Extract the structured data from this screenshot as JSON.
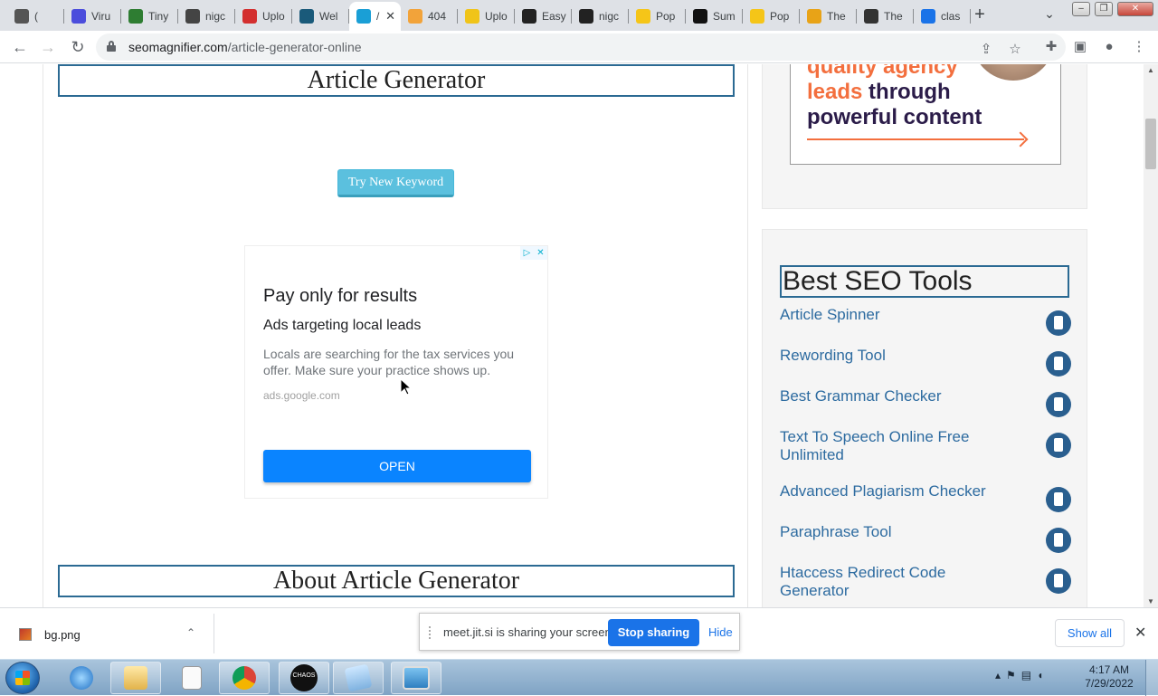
{
  "browser": {
    "tabs": [
      {
        "label": "(",
        "fav_color": "#555555",
        "icon": "pen-icon"
      },
      {
        "label": "Viru",
        "fav_color": "#4b4ddc",
        "icon": "sigma-icon"
      },
      {
        "label": "Tiny",
        "fav_color": "#2e7d32",
        "icon": "link-icon"
      },
      {
        "label": "nigc",
        "fav_color": "#444444",
        "icon": "mountain-icon"
      },
      {
        "label": "Uplo",
        "fav_color": "#d32f2f",
        "icon": "flame-icon"
      },
      {
        "label": "Wel",
        "fav_color": "#1a5a7a",
        "icon": "s-logo-icon"
      },
      {
        "label": "/",
        "fav_color": "#1a9fd6",
        "icon": "seo-icon"
      },
      {
        "label": "404",
        "fav_color": "#f2a33a",
        "icon": "rss-icon"
      },
      {
        "label": "Uplo",
        "fav_color": "#f0c419",
        "icon": "upload-icon"
      },
      {
        "label": "Easy",
        "fav_color": "#222222",
        "icon": "quill-icon"
      },
      {
        "label": "nigc",
        "fav_color": "#222222",
        "icon": "quill-icon"
      },
      {
        "label": "Pop",
        "fav_color": "#f5c518",
        "icon": "smiley-icon"
      },
      {
        "label": "Sum",
        "fav_color": "#111111",
        "icon": "chart-icon"
      },
      {
        "label": "Pop",
        "fav_color": "#f5c518",
        "icon": "smiley-icon"
      },
      {
        "label": "The",
        "fav_color": "#e8a317",
        "icon": "m-logo-icon"
      },
      {
        "label": "The",
        "fav_color": "#333333",
        "icon": "y-logo-icon"
      },
      {
        "label": "clas",
        "fav_color": "#1a73e8",
        "icon": "search-icon"
      }
    ],
    "active_tab_index": 6,
    "new_tab_label": "+",
    "url_host": "seomagnifier.com",
    "url_path": "/article-generator-online"
  },
  "page": {
    "heading": "Article Generator",
    "try_button": "Try New Keyword",
    "about_heading": "About Article Generator",
    "ad": {
      "title": "Pay only for results",
      "subtitle": "Ads targeting local leads",
      "body": "Locals are searching for the tax services you offer. Make sure your practice shows up.",
      "domain": "ads.google.com",
      "cta": "OPEN"
    },
    "promo": {
      "line1": "quality agency",
      "line2a": "leads",
      "line2b": " through",
      "line3": "powerful content",
      "accent": "#f36f3e",
      "dark": "#2b1c49"
    },
    "tools": {
      "title": "Best SEO Tools",
      "items": [
        {
          "label": "Article Spinner",
          "icon": "spinner-icon"
        },
        {
          "label": "Rewording Tool",
          "icon": "document-icon"
        },
        {
          "label": "Best Grammar Checker",
          "icon": "checklist-icon"
        },
        {
          "label": "Text To Speech Online Free Unlimited",
          "icon": "speech-icon"
        },
        {
          "label": "Advanced Plagiarism Checker",
          "icon": "plagiarism-icon"
        },
        {
          "label": "Paraphrase Tool",
          "icon": "pencil-icon"
        },
        {
          "label": "Htaccess Redirect Code Generator",
          "icon": "redirect-icon"
        }
      ]
    }
  },
  "share_bar": {
    "message": "meet.jit.si is sharing your screen.",
    "stop": "Stop sharing",
    "hide": "Hide"
  },
  "downloads": {
    "file": "bg.png",
    "show_all": "Show all"
  },
  "taskbar": {
    "time": "4:17 AM",
    "date": "7/29/2022",
    "chaos_label": "CHAOS"
  }
}
